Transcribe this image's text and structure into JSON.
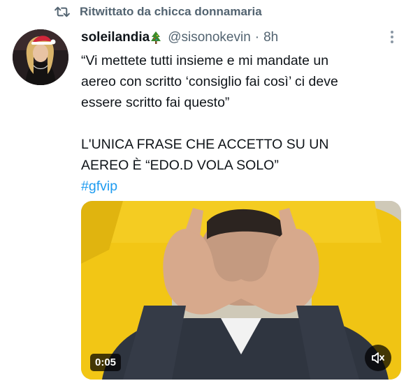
{
  "retweet": {
    "label": "Ritwittato da chicca donnamaria",
    "icon": "retweet-icon"
  },
  "tweet": {
    "display_name": "soleilandia",
    "name_emoji": "christmas-tree-icon",
    "handle": "@sisonokevin",
    "separator": "·",
    "time": "8h",
    "lines": [
      "“Vi mettete tutti insieme e mi mandate un",
      "aereo con scritto ‘consiglio fai così’ ci deve",
      "essere scritto fai questo”",
      "L'UNICA FRASE CHE ACCETTO SU UN",
      "AEREO È “EDO.D VOLA SOLO”"
    ],
    "hashtag": "#gfvip",
    "more_icon": "more-vertical-icon"
  },
  "media": {
    "type": "video",
    "duration": "0:05",
    "mute_icon": "volume-muted-icon"
  },
  "colors": {
    "text": "#0f1419",
    "secondary": "#536471",
    "link": "#1d9bf0"
  }
}
